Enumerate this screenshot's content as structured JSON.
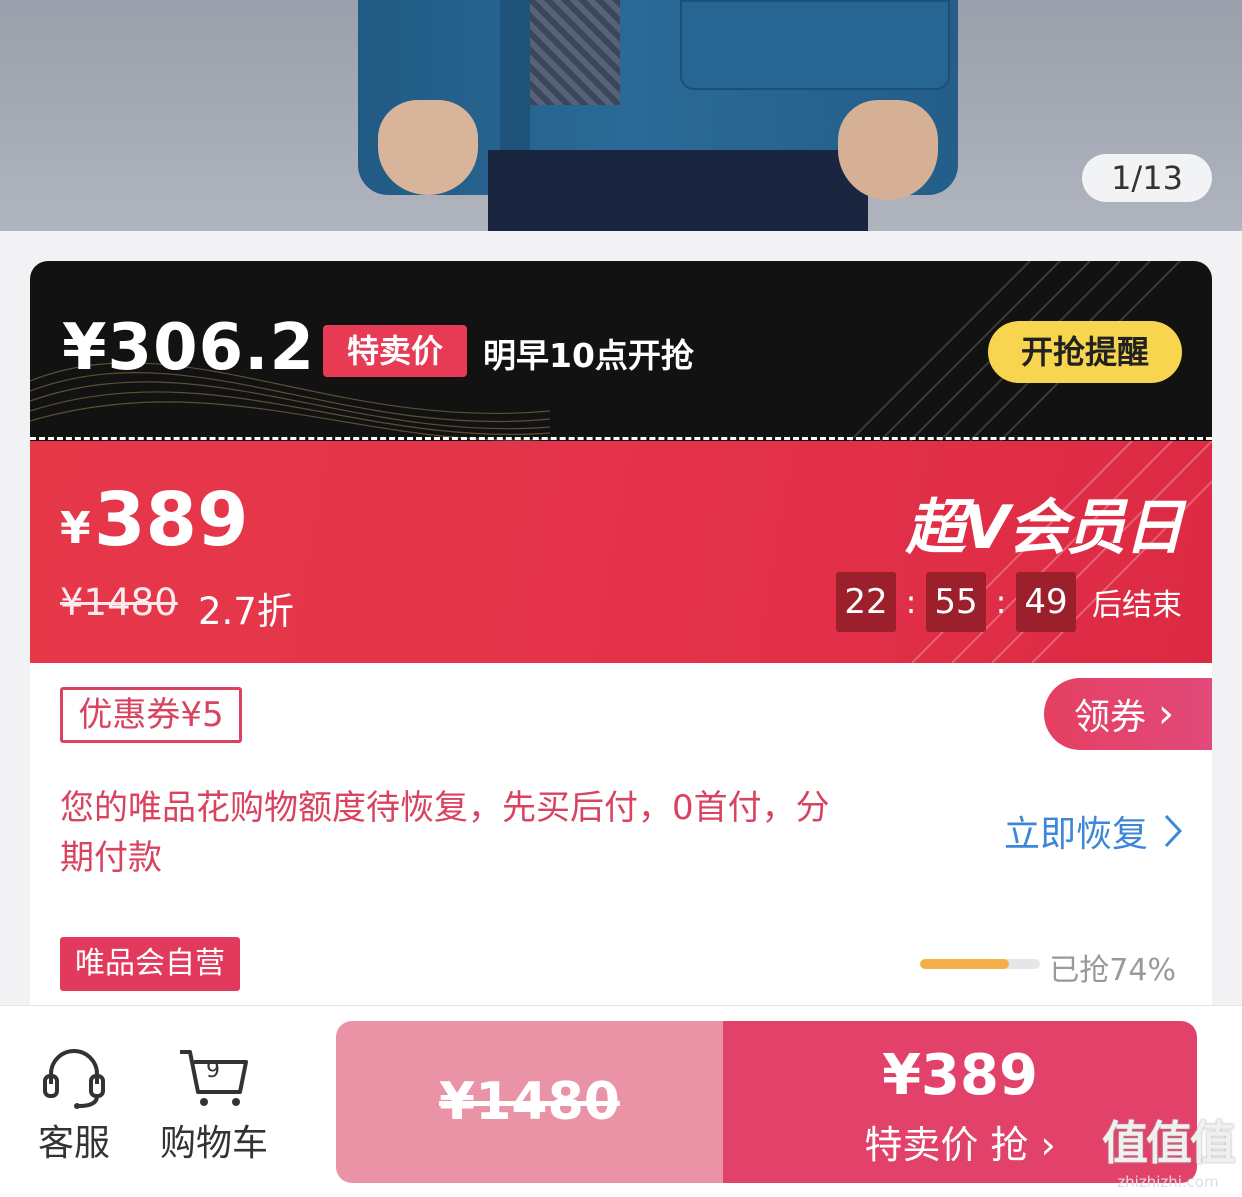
{
  "hero": {
    "image_counter": "1/13"
  },
  "flash_sale": {
    "price": "¥306.2",
    "tag": "特卖价",
    "time_text": "明早10点开抢",
    "remind_button": "开抢提醒",
    "colors": {
      "background": "#121212",
      "tag": "#e63a55",
      "button": "#f7d54e"
    }
  },
  "member_day": {
    "price_symbol": "¥",
    "price": "389",
    "original_price": "¥1480",
    "discount": "2.7折",
    "title": "超V会员日",
    "countdown": {
      "hours": "22",
      "minutes": "55",
      "seconds": "49",
      "suffix": "后结束"
    },
    "colors": {
      "background": "#e3324a"
    }
  },
  "coupon": {
    "label": "优惠券¥5",
    "claim_button": "领券"
  },
  "credit": {
    "message": "您的唯品花购物额度待恢复，先买后付，0首付，分期付款",
    "link": "立即恢复"
  },
  "seller": {
    "tag": "唯品会自营"
  },
  "stock": {
    "grabbed_percent": 74,
    "text": "已抢74%"
  },
  "bottom_bar": {
    "service_label": "客服",
    "cart_label": "购物车",
    "cart_count": "9",
    "original_price": "¥1480",
    "buy_price": "¥389",
    "buy_label": "特卖价 抢"
  },
  "watermark": {
    "logo": "值值值",
    "site": "zhizhizhi.com"
  }
}
